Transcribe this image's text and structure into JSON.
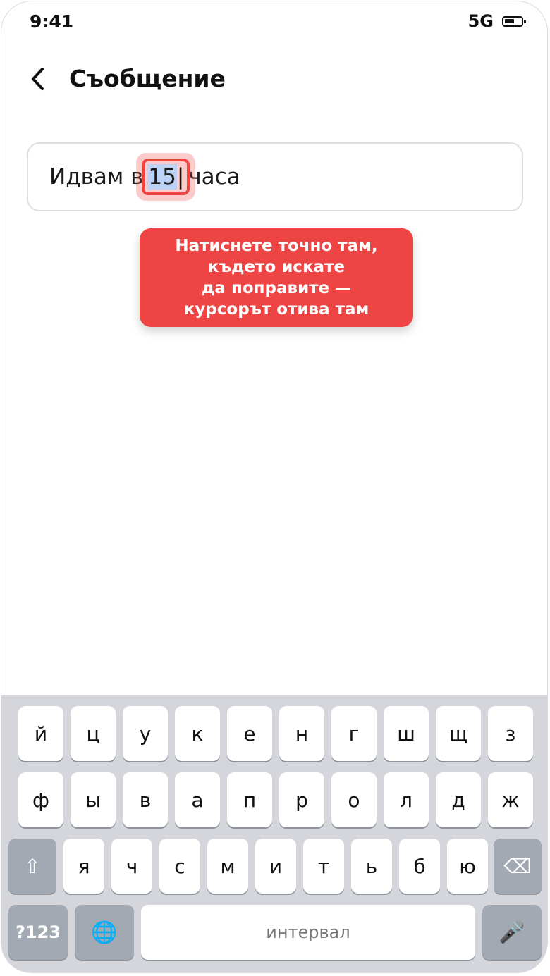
{
  "status_bar": {
    "time": "9:41",
    "network": "5G"
  },
  "header": {
    "title": "Съобщение"
  },
  "message": {
    "text_before": "Идвам в",
    "selected_text": "15",
    "caret": "|",
    "text_after": "часа"
  },
  "tooltip": {
    "lines": [
      "Натиснете точно там,",
      "където искате",
      "да поправите —",
      "курсорът отива там"
    ]
  },
  "keyboard": {
    "row1": [
      "й",
      "ц",
      "у",
      "к",
      "е",
      "н",
      "г",
      "ш",
      "щ",
      "з"
    ],
    "row2": [
      "ф",
      "ы",
      "в",
      "а",
      "п",
      "р",
      "о",
      "л",
      "д",
      "ж"
    ],
    "row3": [
      "я",
      "ч",
      "с",
      "м",
      "и",
      "т",
      "ь",
      "б",
      "ю"
    ],
    "shift_label": "⇧",
    "backspace_label": "⌫",
    "mode_label": "?123",
    "globe_label": "🌐",
    "space_label": "интервал",
    "mic_label": "🎤"
  },
  "colors": {
    "accent_red": "#ef4444",
    "selection_blue": "#bcd3f5",
    "keyboard_bg": "#d4d6dc",
    "dark_key": "#a3a9b3"
  }
}
